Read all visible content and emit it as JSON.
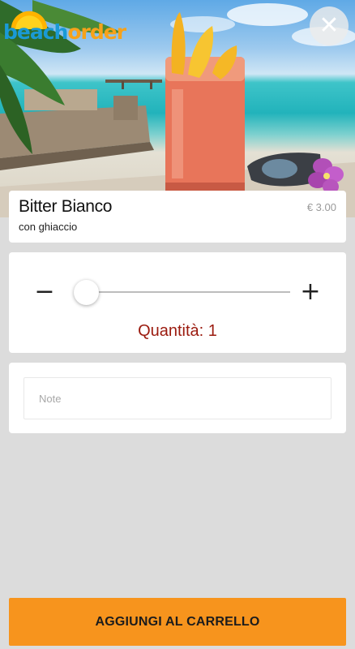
{
  "header": {
    "logo": {
      "part1": "beach",
      "part2": "order"
    },
    "close_icon": "close-icon",
    "close_glyph": "✕"
  },
  "product": {
    "name": "Bitter Bianco",
    "price": "€ 3.00",
    "description": "con ghiaccio"
  },
  "quantity": {
    "minus_glyph": "−",
    "plus_glyph": "+",
    "label": "Quantità: 1",
    "value": 1,
    "slider_fraction": 0
  },
  "note": {
    "placeholder": "Note",
    "value": ""
  },
  "actions": {
    "add_to_cart_label": "AGGIUNGI AL CARRELLO"
  },
  "colors": {
    "accent": "#f7941d",
    "quantity_text": "#9b1b0f",
    "logo_blue": "#1a9ad6",
    "logo_orange": "#f7a21a"
  }
}
